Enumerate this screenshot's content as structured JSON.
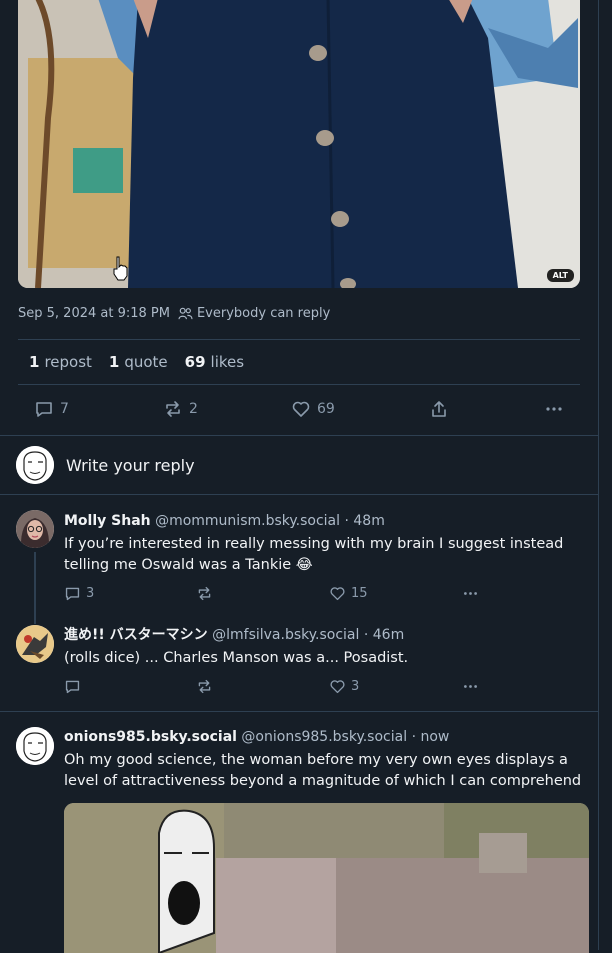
{
  "post": {
    "alt_badge": "ALT",
    "timestamp": "Sep 5, 2024 at 9:18 PM",
    "reply_setting": "Everybody can reply",
    "stats": {
      "reposts_count": "1",
      "reposts_label": "repost",
      "quotes_count": "1",
      "quotes_label": "quote",
      "likes_count": "69",
      "likes_label": "likes"
    },
    "actions": {
      "replies": "7",
      "reposts": "2",
      "likes": "69"
    }
  },
  "reply_box": {
    "placeholder": "Write your reply"
  },
  "replies": [
    {
      "name": "Molly Shah",
      "handle": "@mommunism.bsky.social",
      "time": "· 48m",
      "text": "If you’re interested in really messing with my brain I suggest instead telling me Oswald was a Tankie 😂",
      "replies": "3",
      "reposts": "",
      "likes": "15"
    },
    {
      "name": "進め!! バスターマシン",
      "handle": "@lmfsilva.bsky.social",
      "time": "· 46m",
      "text": "(rolls dice) ... Charles Manson was a... Posadist.",
      "replies": "",
      "reposts": "",
      "likes": "3"
    },
    {
      "name": "onions985.bsky.social",
      "handle": "@onions985.bsky.social",
      "time": "· now",
      "text": "Oh my good science, the woman before my very own eyes displays a level of attractiveness beyond a magnitude of which I can comprehend"
    }
  ],
  "colors": {
    "background": "#161e27",
    "border": "#2e4052",
    "muted": "#8a9aab",
    "text": "#f1f3f5"
  }
}
